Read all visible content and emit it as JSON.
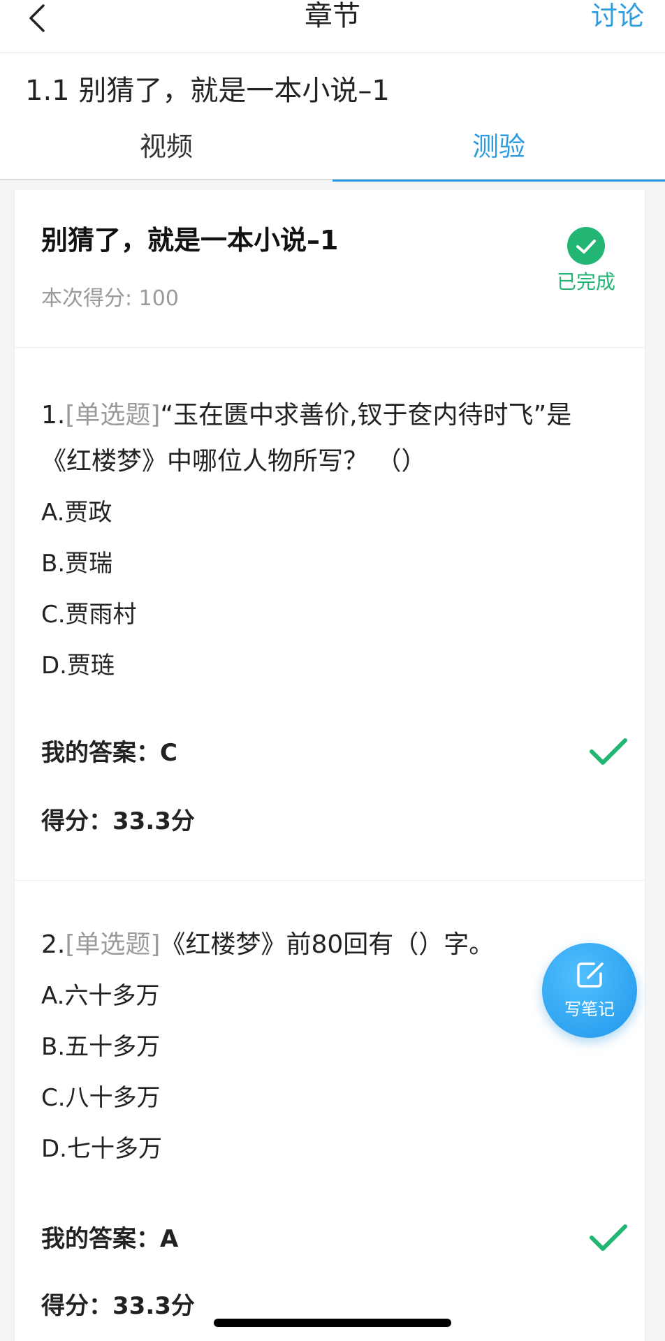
{
  "nav": {
    "title": "章节",
    "right_label": "讨论"
  },
  "lesson": {
    "title": "1.1 别猜了，就是一本小说–1"
  },
  "tabs": [
    {
      "label": "视频"
    },
    {
      "label": "测验"
    }
  ],
  "quiz": {
    "name": "别猜了，就是一本小说–1",
    "score_text": "本次得分: 100",
    "status": "已完成",
    "questions": [
      {
        "number": "1.",
        "type": "[单选题]",
        "text_line1": "“玉在匮中求善价,钗于奁内待时飞”是",
        "text_line2": "《红楼梦》中哪位人物所写？ （）",
        "options": [
          "A.贾政",
          "B.贾瑞",
          "C.贾雨村",
          "D.贾琏"
        ],
        "my_answer": "我的答案：C",
        "score": "得分：33.3分"
      },
      {
        "number": "2.",
        "type": "[单选题]",
        "text_line1": "《红楼梦》前80回有（）字。",
        "options": [
          "A.六十多万",
          "B.五十多万",
          "C.八十多万",
          "D.七十多万"
        ],
        "my_answer": "我的答案：A",
        "score": "得分：33.3分"
      }
    ]
  },
  "note_button": {
    "label": "写笔记"
  },
  "colors": {
    "accent": "#2c9be0",
    "success": "#22b573",
    "muted": "#9a9a9a"
  }
}
